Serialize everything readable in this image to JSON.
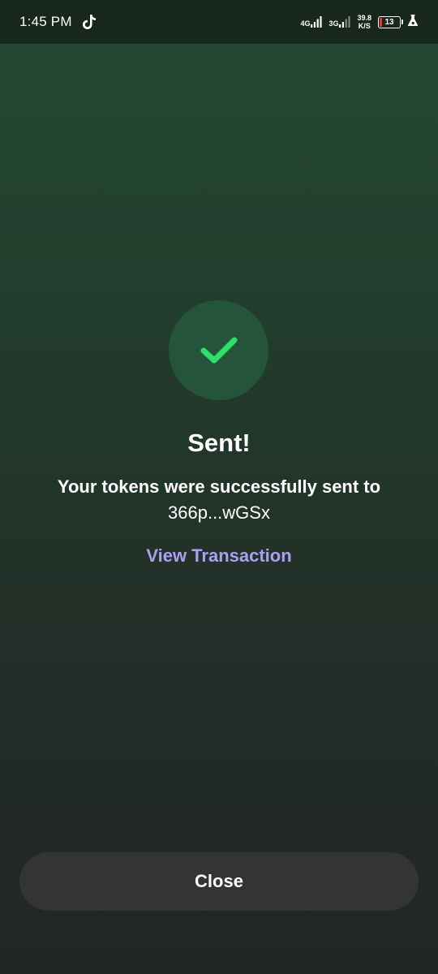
{
  "status_bar": {
    "time": "1:45 PM",
    "network_1": "4G",
    "network_2": "3G",
    "speed_value": "39.8",
    "speed_unit": "K/S",
    "battery_level": "13",
    "battery_fraction": 0.13,
    "battery_color": "#e53935"
  },
  "result": {
    "icon": "check-icon",
    "title": "Sent!",
    "message_bold": "Your tokens were successfully sent to",
    "address": "366p...wGSx",
    "view_link_label": "View Transaction"
  },
  "footer": {
    "close_label": "Close"
  },
  "colors": {
    "accent_link": "#ab9ff2",
    "success": "#2ee06a",
    "button_bg": "#343434"
  }
}
